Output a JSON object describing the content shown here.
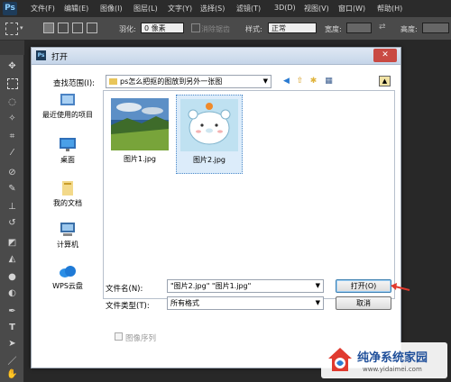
{
  "app": {
    "logo": "Ps",
    "menu": [
      "文件(F)",
      "编辑(E)",
      "图像(I)",
      "图层(L)",
      "文字(Y)",
      "选择(S)",
      "滤镜(T)",
      "3D(D)",
      "视图(V)",
      "窗口(W)",
      "帮助(H)"
    ]
  },
  "options_bar": {
    "feather_label": "羽化:",
    "feather_value": "0 像素",
    "antialias_label": "消除锯齿",
    "style_label": "样式:",
    "style_value": "正常",
    "width_label": "宽度:",
    "height_label": "高度:"
  },
  "dialog": {
    "title": "打开",
    "close_glyph": "✕",
    "look_in_label": "查找范围(I):",
    "look_in_value": "ps怎么把抠的图放到另外一张图",
    "places": [
      {
        "label": "最近使用的项目",
        "icon": "recent-icon"
      },
      {
        "label": "桌面",
        "icon": "desktop-icon"
      },
      {
        "label": "我的文档",
        "icon": "documents-icon"
      },
      {
        "label": "计算机",
        "icon": "computer-icon"
      },
      {
        "label": "WPS云盘",
        "icon": "cloud-icon"
      }
    ],
    "files": [
      {
        "name": "图片1.jpg",
        "icon": "landscape-thumbnail"
      },
      {
        "name": "图片2.jpg",
        "icon": "bear-thumbnail"
      }
    ],
    "filename_label": "文件名(N):",
    "filename_value": "\"图片2.jpg\" \"图片1.jpg\"",
    "filetype_label": "文件类型(T):",
    "filetype_value": "所有格式",
    "open_button": "打开(O)",
    "cancel_button": "取消",
    "image_sequence_label": "图像序列"
  },
  "watermark": {
    "title": "纯净系统家园",
    "url": "www.yidaimei.com"
  },
  "colors": {
    "accent_red": "#e03a2f",
    "selection_blue": "#cce4f7"
  }
}
